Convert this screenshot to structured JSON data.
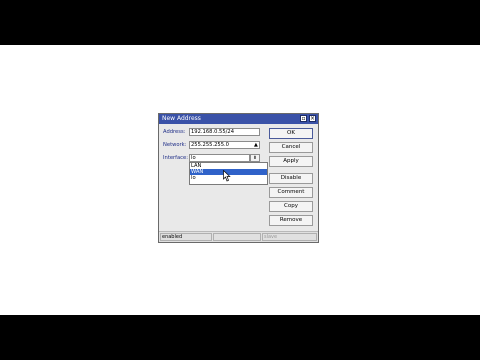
{
  "dialog": {
    "title": "New Address",
    "max_icon": "maximize-icon",
    "close_icon": "close-icon",
    "fields": {
      "address_label": "Address:",
      "address_value": "192.168.0.55/24",
      "network_label": "Network:",
      "network_value": "255.255.255.0",
      "interface_label": "Interface:",
      "interface_value": "lo"
    },
    "dropdown_options": [
      "LAN",
      "WAN",
      "lo"
    ],
    "selected_option": "WAN",
    "buttons": {
      "ok": "OK",
      "cancel": "Cancel",
      "apply": "Apply",
      "disable": "Disable",
      "comment": "Comment",
      "copy": "Copy",
      "remove": "Remove"
    },
    "status": {
      "state": "enabled",
      "middle": "",
      "right": "slave"
    }
  },
  "colors": {
    "titlebar": "#3a52a8",
    "label": "#1d2c86",
    "selection": "#2f62c9"
  }
}
